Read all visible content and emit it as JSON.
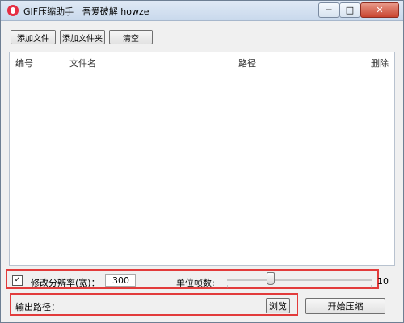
{
  "window": {
    "title": "GIF压缩助手 | 吾爱破解 howze"
  },
  "controls": {
    "minimize": "─",
    "maximize": "□",
    "close": "✕"
  },
  "toolbar": {
    "add_file": "添加文件",
    "add_folder": "添加文件夹",
    "clear": "清空"
  },
  "list": {
    "columns": [
      "编号",
      "文件名",
      "路径",
      "删除"
    ],
    "rows": []
  },
  "options": {
    "modify_resolution_checked": true,
    "modify_resolution_label": "修改分辨率(宽)：",
    "width_value": "300",
    "frame_unit_label": "单位帧数:",
    "frame_value": "10",
    "frame_slider_level": 0.32
  },
  "output": {
    "path_label": "输出路径：",
    "path_value": "",
    "browse_label": "浏览",
    "start_label": "开始压缩"
  },
  "colors": {
    "highlight_box": "#e23b3b",
    "app_icon": "#e52e44"
  }
}
